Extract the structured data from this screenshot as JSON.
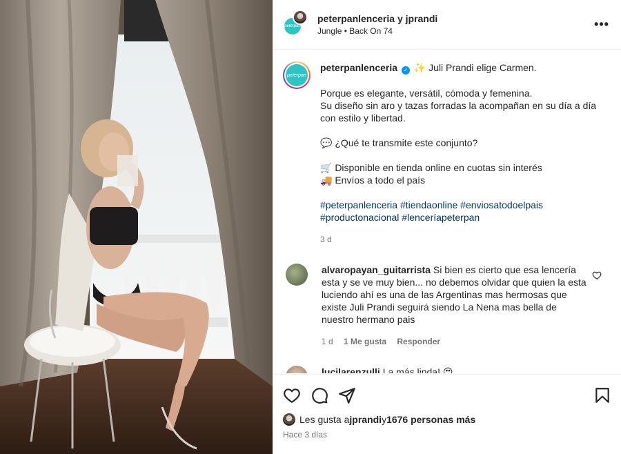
{
  "header": {
    "accounts": "peterpanlenceria y jprandi",
    "audio": "Jungle • Back On 74",
    "more": "•••",
    "avatar_text": "peterpan"
  },
  "caption": {
    "username": "peterpanlenceria",
    "verified_glyph": "✓",
    "line1": "✨ Juli Prandi elige Carmen.",
    "para1": "Porque es elegante, versátil, cómoda y femenina.",
    "para2": "Su diseño sin aro y tazas forradas la acompañan en su día a día con estilo y libertad.",
    "question": "💬 ¿Qué te transmite este conjunto?",
    "shop1": "🛒 Disponible en tienda online en cuotas sin interés",
    "shop2": "🚚 Envíos a todo el país",
    "hashtags": "#peterpanlenceria #tiendaonline #enviosatodoelpais #productonacional #lenceríapeterpan",
    "time": "3 d"
  },
  "comments": [
    {
      "username": "alvaropayan_guitarrista",
      "text": "Si bien es cierto que esa lencería esta y se ve muy bien... no debemos olvidar que quien la esta luciendo ahí es una de las Argentinas mas hermosas que existe Juli Prandi seguirá siendo La Nena mas bella de nuestro hermano pais",
      "time": "1 d",
      "likes": "1 Me gusta",
      "reply": "Responder"
    },
    {
      "username": "lucilarenzulli",
      "text": "La más linda! 😍"
    }
  ],
  "footer": {
    "likes_prefix": "Les gusta a ",
    "likes_user": "jprandi",
    "likes_mid": " y ",
    "likes_count": "1676 personas más",
    "posted": "Hace 3 días"
  }
}
